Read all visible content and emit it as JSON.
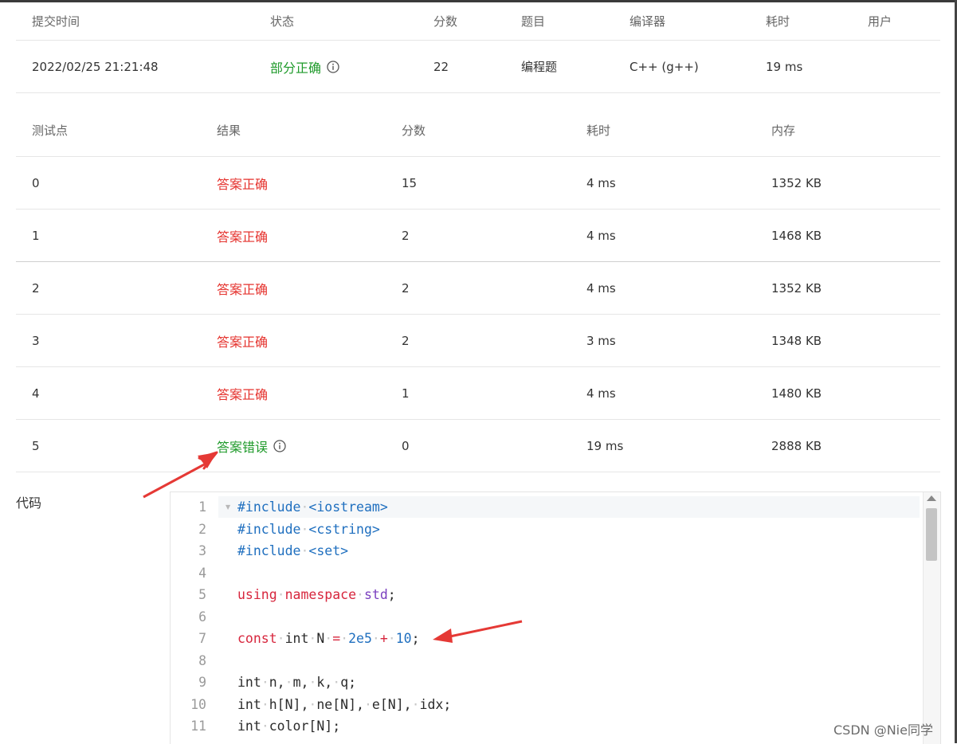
{
  "submission": {
    "headers": [
      "提交时间",
      "状态",
      "分数",
      "题目",
      "编译器",
      "耗时",
      "用户"
    ],
    "row": {
      "time": "2022/02/25 21:21:48",
      "status": "部分正确",
      "score": "22",
      "problem": "编程题",
      "compiler": "C++ (g++)",
      "elapsed": "19 ms",
      "user": ""
    }
  },
  "testcases": {
    "headers": [
      "测试点",
      "结果",
      "分数",
      "耗时",
      "内存"
    ],
    "rows": [
      {
        "id": "0",
        "result": "答案正确",
        "score": "15",
        "time": "4 ms",
        "memory": "1352 KB"
      },
      {
        "id": "1",
        "result": "答案正确",
        "score": "2",
        "time": "4 ms",
        "memory": "1468 KB"
      },
      {
        "id": "2",
        "result": "答案正确",
        "score": "2",
        "time": "4 ms",
        "memory": "1352 KB"
      },
      {
        "id": "3",
        "result": "答案正确",
        "score": "2",
        "time": "3 ms",
        "memory": "1348 KB"
      },
      {
        "id": "4",
        "result": "答案正确",
        "score": "1",
        "time": "4 ms",
        "memory": "1480 KB"
      },
      {
        "id": "5",
        "result": "答案错误",
        "score": "0",
        "time": "19 ms",
        "memory": "2888 KB"
      }
    ]
  },
  "code": {
    "label": "代码",
    "line_numbers": [
      "1",
      "2",
      "3",
      "4",
      "5",
      "6",
      "7",
      "8",
      "9",
      "10",
      "11"
    ],
    "lines": [
      "#include <iostream>",
      "#include <cstring>",
      "#include <set>",
      "",
      "using namespace std;",
      "",
      "const int N = 2e5 + 10;",
      "",
      "int n, m, k, q;",
      "int h[N], ne[N], e[N], idx;",
      "int color[N];"
    ]
  },
  "colors": {
    "correct": "#e5322d",
    "wrong_and_partial": "#1e9a2a",
    "annotation_arrow": "#e53935"
  },
  "watermark": "CSDN @Nie同学"
}
